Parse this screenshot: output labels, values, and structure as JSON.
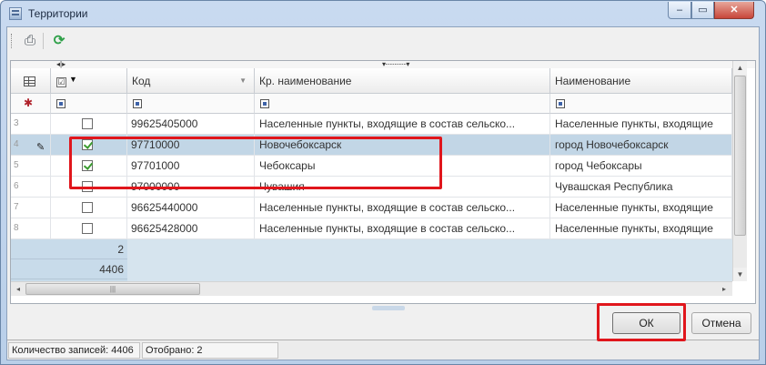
{
  "window": {
    "title": "Территории",
    "min_glyph": "‒",
    "max_glyph": "▭",
    "close_glyph": "✕"
  },
  "toolbar": {
    "print_glyph": "⎙",
    "refresh_glyph": "⟳"
  },
  "grid": {
    "band_left_glyph": "◂|▸",
    "band_mid_glyph": "▾··············▾",
    "columns": {
      "checkbox_header_glyph": "☑",
      "checkbox_header_arrow": "▼",
      "kod": "Код",
      "kr_name": "Кр. наименование",
      "name": "Наименование",
      "sort_glyph": "▼"
    },
    "filter_pin_glyph": "✱",
    "rows": [
      {
        "num": "3",
        "checked": false,
        "kod": "99625405000",
        "kr": "Населенные пункты, входящие в состав сельско...",
        "name": "Населенные пункты, входящие",
        "selected": false
      },
      {
        "num": "4",
        "checked": true,
        "kod": "97710000",
        "kr": "Новочебоксарск",
        "name": "город Новочебоксарск",
        "selected": true
      },
      {
        "num": "5",
        "checked": true,
        "kod": "97701000",
        "kr": "Чебоксары",
        "name": "город Чебоксары",
        "selected": false
      },
      {
        "num": "6",
        "checked": false,
        "kod": "97000000",
        "kr": "Чувашия",
        "name": "Чувашская Республика",
        "selected": false
      },
      {
        "num": "7",
        "checked": false,
        "kod": "96625440000",
        "kr": "Населенные пункты, входящие в состав сельско...",
        "name": "Населенные пункты, входящие",
        "selected": false
      },
      {
        "num": "8",
        "checked": false,
        "kod": "96625428000",
        "kr": "Населенные пункты, входящие в состав сельско...",
        "name": "Населенные пункты, входящие",
        "selected": false
      }
    ],
    "edit_indicator_glyph": "✎",
    "footer": {
      "selected_count": "2",
      "total_count": "4406"
    },
    "scroll": {
      "up": "▲",
      "down": "▼",
      "left": "◂",
      "right": "▸",
      "h_thumb_grip": "|||"
    }
  },
  "buttons": {
    "ok": "ОК",
    "cancel": "Отмена"
  },
  "status": {
    "records": "Количество записей: 4406",
    "selected": "Отобрано: 2"
  },
  "colors": {
    "highlight": "#e0161c",
    "selected_row": "#c2d6e6",
    "check": "#3a9b2f"
  }
}
